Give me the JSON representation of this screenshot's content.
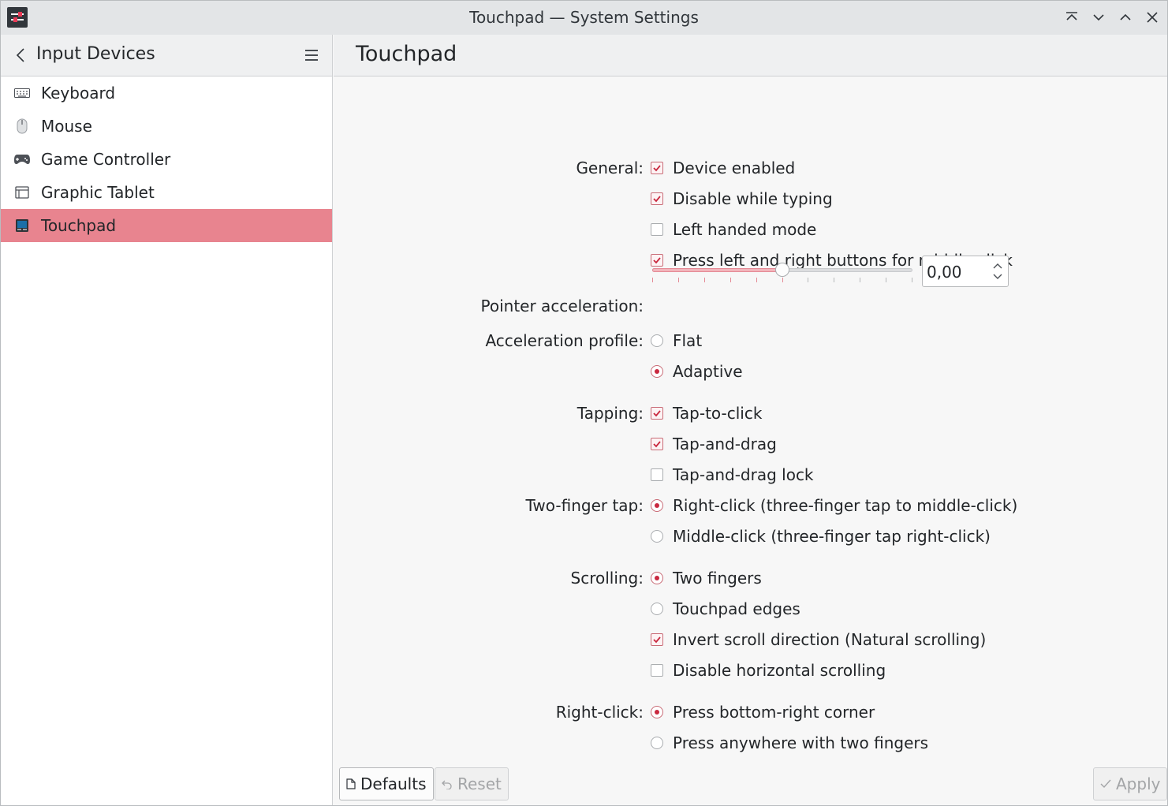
{
  "window": {
    "title": "Touchpad — System Settings"
  },
  "sidebar": {
    "title": "Input Devices",
    "items": [
      {
        "label": "Keyboard",
        "icon": "keyboard-icon",
        "active": false
      },
      {
        "label": "Mouse",
        "icon": "mouse-icon",
        "active": false
      },
      {
        "label": "Game Controller",
        "icon": "gamepad-icon",
        "active": false
      },
      {
        "label": "Graphic Tablet",
        "icon": "tablet-icon",
        "active": false
      },
      {
        "label": "Touchpad",
        "icon": "touchpad-icon",
        "active": true
      }
    ]
  },
  "main": {
    "title": "Touchpad",
    "general": {
      "label": "General:",
      "options": [
        {
          "label": "Device enabled",
          "checked": true
        },
        {
          "label": "Disable while typing",
          "checked": true
        },
        {
          "label": "Left handed mode",
          "checked": false
        },
        {
          "label": "Press left and right buttons for middle click",
          "checked": true
        }
      ]
    },
    "pointer_acceleration": {
      "label": "Pointer acceleration:",
      "value_text": "0,00",
      "slider_fraction": 0.5
    },
    "acceleration_profile": {
      "label": "Acceleration profile:",
      "options": [
        {
          "label": "Flat",
          "selected": false
        },
        {
          "label": "Adaptive",
          "selected": true
        }
      ]
    },
    "tapping": {
      "label": "Tapping:",
      "options": [
        {
          "label": "Tap-to-click",
          "checked": true
        },
        {
          "label": "Tap-and-drag",
          "checked": true
        },
        {
          "label": "Tap-and-drag lock",
          "checked": false
        }
      ]
    },
    "two_finger_tap": {
      "label": "Two-finger tap:",
      "options": [
        {
          "label": "Right-click (three-finger tap to middle-click)",
          "selected": true
        },
        {
          "label": "Middle-click (three-finger tap right-click)",
          "selected": false
        }
      ]
    },
    "scrolling": {
      "label": "Scrolling:",
      "radio_options": [
        {
          "label": "Two fingers",
          "selected": true
        },
        {
          "label": "Touchpad edges",
          "selected": false
        }
      ],
      "check_options": [
        {
          "label": "Invert scroll direction (Natural scrolling)",
          "checked": true
        },
        {
          "label": "Disable horizontal scrolling",
          "checked": false
        }
      ]
    },
    "right_click": {
      "label": "Right-click:",
      "options": [
        {
          "label": "Press bottom-right corner",
          "selected": true
        },
        {
          "label": "Press anywhere with two fingers",
          "selected": false
        }
      ]
    }
  },
  "footer": {
    "defaults_label": "Defaults",
    "reset_label": "Reset",
    "apply_label": "Apply"
  },
  "colors": {
    "accent": "#e8848f",
    "check": "#c9283f"
  }
}
